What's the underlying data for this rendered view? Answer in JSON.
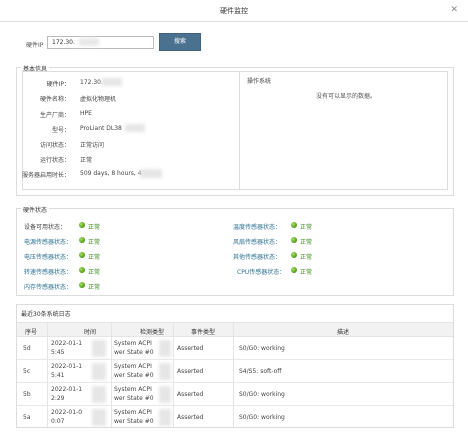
{
  "window": {
    "title": "硬件监控",
    "close_glyph": "✕"
  },
  "query": {
    "ip_label": "硬件IP",
    "ip_value": "172.30.",
    "button_label": "搜索"
  },
  "basic_info": {
    "legend": "基本信息",
    "fields": [
      {
        "label": "硬件IP：",
        "value": "172.30."
      },
      {
        "label": "硬件名称：",
        "value": "虚拟化物理机"
      },
      {
        "label": "生产厂商：",
        "value": "HPE"
      },
      {
        "label": "型号：",
        "value": "ProLiant DL38"
      },
      {
        "label": "访问状态：",
        "value": "正常访问"
      },
      {
        "label": "运行状态：",
        "value": "正常"
      },
      {
        "label": "服务器启用时长：",
        "value": "509 days, 8 hours, 4"
      }
    ]
  },
  "os": {
    "header": "操作系统",
    "empty_text": "没有可以显示的数据。"
  },
  "hardware_status": {
    "legend": "硬件状态",
    "ok_text": "正常",
    "left": [
      "设备可用状态：",
      "电源传感器状态：",
      "电压传感器状态：",
      "转速传感器状态：",
      "内存传感器状态："
    ],
    "right": [
      "温度传感器状态：",
      "风扇传感器状态：",
      "其他传感器状态：",
      "CPU传感器状态："
    ],
    "dot_color": "#4c9a12"
  },
  "log": {
    "title": "最近30条系统日志",
    "columns": [
      "序号",
      "时间",
      "检测类型",
      "事件类型",
      "描述"
    ],
    "rows": [
      {
        "id": "5d",
        "time_1": "2022-01-1",
        "time_2": "5:45",
        "type_1": "System ACPI",
        "type_2": "wer State #0",
        "event": "Asserted",
        "desc": "S0/G0: working"
      },
      {
        "id": "5c",
        "time_1": "2022-01-1",
        "time_2": "5:41",
        "type_1": "System ACPI",
        "type_2": "wer State #0",
        "event": "Asserted",
        "desc": "S4/S5: soft-off"
      },
      {
        "id": "5b",
        "time_1": "2022-01-1",
        "time_2": "2:29",
        "type_1": "System ACPI",
        "type_2": "wer State #0",
        "event": "Asserted",
        "desc": "S0/G0: working"
      },
      {
        "id": "5a",
        "time_1": "2022-01-0",
        "time_2": "0:07",
        "type_1": "System ACPI",
        "type_2": "wer State #0",
        "event": "Asserted",
        "desc": "S0/G0: working"
      }
    ]
  },
  "colors": {
    "button": "#4a7190",
    "link_label": "#2b6f8f",
    "ok_text": "#3a8a1c"
  }
}
